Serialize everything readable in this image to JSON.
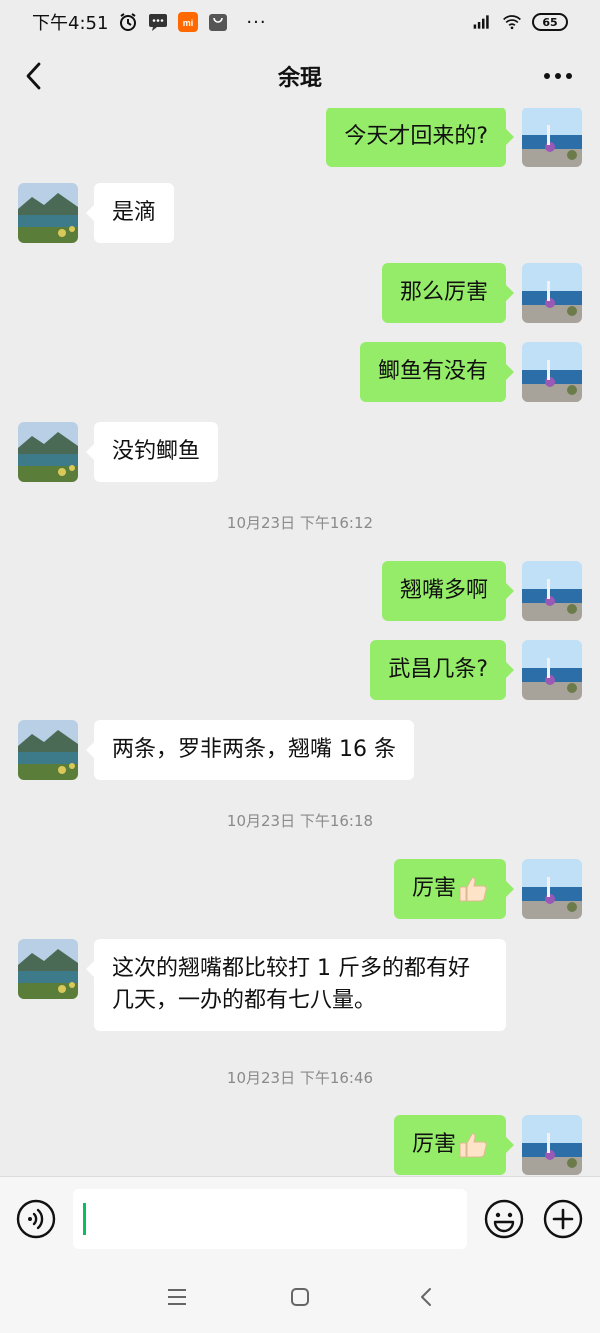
{
  "status_bar": {
    "time": "下午4:51",
    "more_dots": "···",
    "battery": "65"
  },
  "header": {
    "title": "余琨"
  },
  "messages": [
    {
      "side": "right",
      "text": "今天才回来的?"
    },
    {
      "side": "left",
      "text": "是滴"
    },
    {
      "side": "right",
      "text": "那么厉害"
    },
    {
      "side": "right",
      "text": "鲫鱼有没有"
    },
    {
      "side": "left",
      "text": "没钓鲫鱼"
    },
    {
      "type": "time",
      "text": "10月23日 下午16:12"
    },
    {
      "side": "right",
      "text": "翘嘴多啊"
    },
    {
      "side": "right",
      "text": "武昌几条?"
    },
    {
      "side": "left",
      "text": "两条，罗非两条，翘嘴 16 条"
    },
    {
      "type": "time",
      "text": "10月23日 下午16:18"
    },
    {
      "side": "right",
      "text": "厉害",
      "emoji": "thumbs-up"
    },
    {
      "side": "left",
      "text": "这次的翘嘴都比较打 1 斤多的都有好几天，一办的都有七八量。"
    },
    {
      "type": "time",
      "text": "10月23日 下午16:46"
    },
    {
      "side": "right",
      "text": "厉害",
      "emoji": "thumbs-up"
    }
  ],
  "input_bar": {
    "voice_icon": "voice-icon",
    "emoji_icon": "emoji-icon",
    "plus_icon": "plus-icon"
  },
  "colors": {
    "background": "#ededed",
    "my_bubble": "#95ec69",
    "their_bubble": "#ffffff",
    "caret": "#07c160"
  }
}
